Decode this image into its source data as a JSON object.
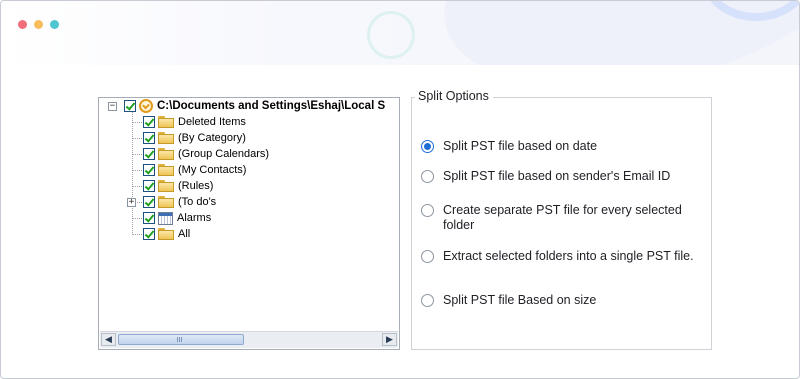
{
  "window": {
    "controls": [
      {
        "name": "close",
        "color": "#f16f7d"
      },
      {
        "name": "minimize",
        "color": "#f7bd5a"
      },
      {
        "name": "maximize",
        "color": "#4fc6d1"
      }
    ]
  },
  "tree": {
    "root": {
      "label": "C:\\Documents and Settings\\Eshaj\\Local S",
      "expander": "−",
      "checked": true
    },
    "items": [
      {
        "label": "Deleted Items",
        "icon": "folder-icon",
        "checked": true
      },
      {
        "label": "(By Category)",
        "icon": "folder-icon",
        "checked": true
      },
      {
        "label": "(Group Calendars)",
        "icon": "folder-icon",
        "checked": true
      },
      {
        "label": "(My Contacts)",
        "icon": "folder-icon",
        "checked": true
      },
      {
        "label": "(Rules)",
        "icon": "folder-icon",
        "checked": true
      },
      {
        "label": "(To do's",
        "icon": "folder-icon",
        "checked": true,
        "expander": "+"
      },
      {
        "label": "Alarms",
        "icon": "calendar-icon",
        "checked": true
      },
      {
        "label": "All",
        "icon": "folder-icon",
        "checked": true
      }
    ],
    "scrollbar": {
      "left_arrow": "◀",
      "right_arrow": "▶"
    }
  },
  "split_options": {
    "title": "Split Options",
    "selected": 0,
    "options": [
      "Split PST file based on date",
      "Split PST file based on sender's Email ID",
      "Create separate PST file for every selected folder",
      "Extract selected folders into a single PST file.",
      "Split PST file Based on size"
    ]
  }
}
